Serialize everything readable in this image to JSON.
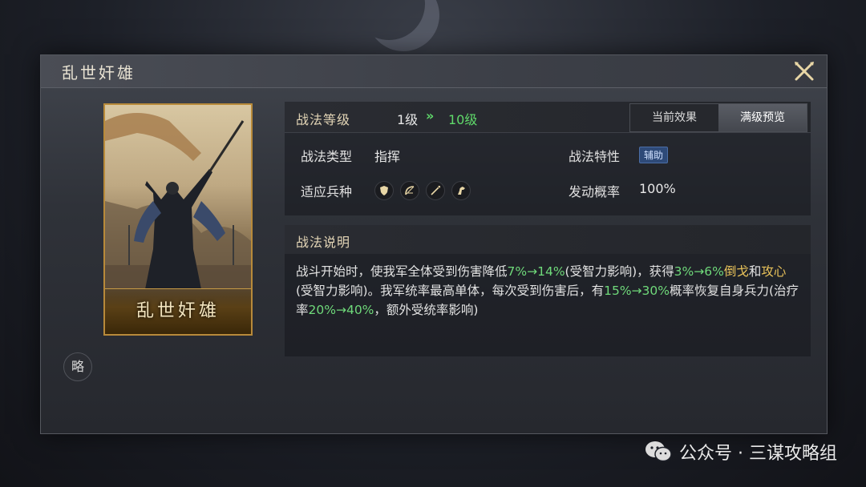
{
  "dialog": {
    "title": "乱世奸雄",
    "card_name": "乱世奸雄",
    "side_button": "略"
  },
  "level": {
    "label": "战法等级",
    "from": "1级",
    "arrow": "»",
    "to": "10级"
  },
  "tabs": [
    {
      "label": "当前效果",
      "active": false
    },
    {
      "label": "满级预览",
      "active": true
    }
  ],
  "attributes": {
    "type_label": "战法类型",
    "type_value": "指挥",
    "trait_label": "战法特性",
    "trait_value": "辅助",
    "troops_label": "适应兵种",
    "troop_icons": [
      "shield-icon",
      "bow-icon",
      "spear-icon",
      "horse-icon"
    ],
    "rate_label": "发动概率",
    "rate_value": "100%"
  },
  "description": {
    "title": "战法说明",
    "segments": [
      {
        "t": "战斗开始时，使我军全体受到伤害降低",
        "c": ""
      },
      {
        "t": "7%→14%",
        "c": "g"
      },
      {
        "t": "(受智力影响)，获得",
        "c": ""
      },
      {
        "t": "3%→6%",
        "c": "g"
      },
      {
        "t": "倒戈",
        "c": "y"
      },
      {
        "t": "和",
        "c": ""
      },
      {
        "t": "攻心",
        "c": "y"
      },
      {
        "t": "(受智力影响)。我军统率最高单体，每次受到伤害后，有",
        "c": ""
      },
      {
        "t": "15%→30%",
        "c": "g"
      },
      {
        "t": "概率恢复自身兵力(治疗率",
        "c": ""
      },
      {
        "t": "20%→40%",
        "c": "g"
      },
      {
        "t": "，额外受统率影响)",
        "c": ""
      }
    ]
  },
  "watermark": {
    "text": "公众号 · 三谋攻略组"
  },
  "colors": {
    "green": "#6fd97a",
    "gold": "#e8c25a",
    "frame_gold": "#b88a3a"
  }
}
